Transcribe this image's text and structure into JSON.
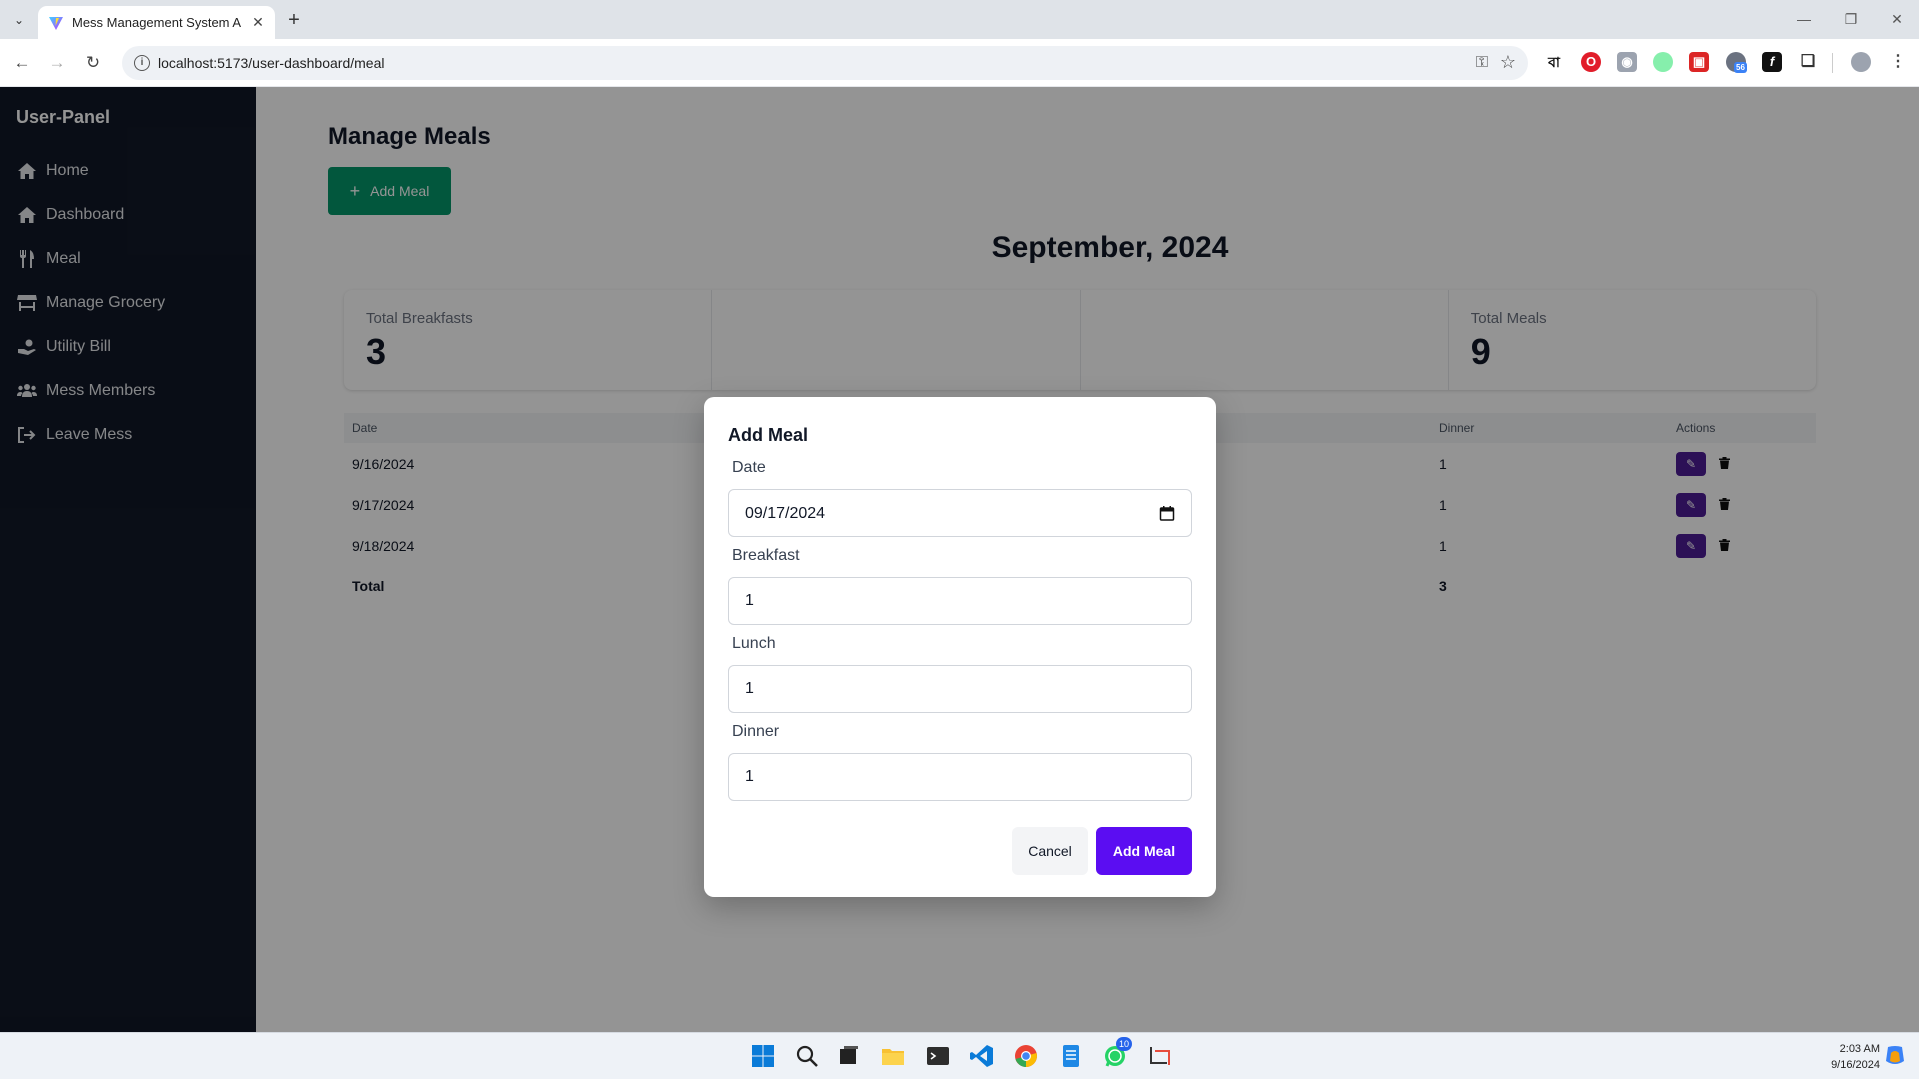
{
  "browser": {
    "tab_title": "Mess Management System Arm",
    "url": "localhost:5173/user-dashboard/meal",
    "extension_badge": "56"
  },
  "sidebar": {
    "brand": "User-Panel",
    "items": [
      {
        "label": "Home",
        "icon": "home-icon"
      },
      {
        "label": "Dashboard",
        "icon": "home-icon"
      },
      {
        "label": "Meal",
        "icon": "utensils-icon"
      },
      {
        "label": "Manage Grocery",
        "icon": "store-icon"
      },
      {
        "label": "Utility Bill",
        "icon": "bill-icon"
      },
      {
        "label": "Mess Members",
        "icon": "users-icon"
      },
      {
        "label": "Leave Mess",
        "icon": "logout-icon"
      }
    ]
  },
  "main": {
    "page_title": "Manage Meals",
    "add_button": "Add Meal",
    "month_title": "September, 2024",
    "stats": [
      {
        "label": "Total Breakfasts",
        "value": "3"
      },
      {
        "label": "",
        "value": ""
      },
      {
        "label": "",
        "value": ""
      },
      {
        "label": "Total Meals",
        "value": "9"
      }
    ],
    "table": {
      "headers": [
        "Date",
        "",
        "",
        "Dinner",
        "Actions"
      ],
      "rows": [
        {
          "date": "9/16/2024",
          "dinner": "1"
        },
        {
          "date": "9/17/2024",
          "dinner": "1"
        },
        {
          "date": "9/18/2024",
          "dinner": "1"
        }
      ],
      "total_label": "Total",
      "total_dinner": "3"
    }
  },
  "modal": {
    "title": "Add Meal",
    "date_label": "Date",
    "date_value": "09/17/2024",
    "breakfast_label": "Breakfast",
    "breakfast_value": "1",
    "lunch_label": "Lunch",
    "lunch_value": "1",
    "dinner_label": "Dinner",
    "dinner_value": "1",
    "cancel_label": "Cancel",
    "submit_label": "Add Meal"
  },
  "taskbar": {
    "time": "2:03 AM",
    "date": "9/16/2024",
    "whatsapp_badge": "10"
  },
  "colors": {
    "sidebar_bg": "#111827",
    "add_button_green": "#059669",
    "primary_purple": "#5b0df2",
    "edit_purple": "#4c1d95"
  }
}
